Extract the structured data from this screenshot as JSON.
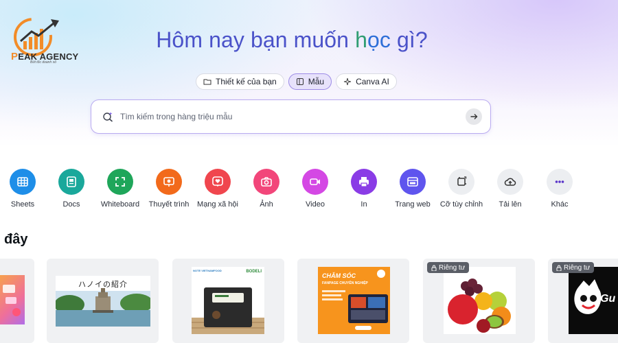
{
  "brand": {
    "logo_text": "EAK AGENCY",
    "logo_initial": "P",
    "tagline": "Bứt tốc doanh số"
  },
  "hero": {
    "headline_pre": "Hôm nay bạn muốn ",
    "headline_h": "h",
    "headline_oc": "ọc",
    "headline_post": " gì?"
  },
  "tabs": [
    {
      "label": "Thiết kế của bạn",
      "icon": "folder-icon",
      "active": false
    },
    {
      "label": "Mẫu",
      "icon": "template-icon",
      "active": true
    },
    {
      "label": "Canva AI",
      "icon": "sparkle-icon",
      "active": false
    }
  ],
  "search": {
    "placeholder": "Tìm kiếm trong hàng triệu mẫu"
  },
  "categories": [
    {
      "label": "Sheets",
      "icon": "sheets-icon",
      "color": "#1e8ee8"
    },
    {
      "label": "Docs",
      "icon": "docs-icon",
      "color": "#1aa89b"
    },
    {
      "label": "Whiteboard",
      "icon": "whiteboard-icon",
      "color": "#1fa65a"
    },
    {
      "label": "Thuyết trình",
      "icon": "presentation-icon",
      "color": "#f26a1b"
    },
    {
      "label": "Mạng xã hội",
      "icon": "social-heart-icon",
      "color": "#f0464e"
    },
    {
      "label": "Ảnh",
      "icon": "camera-icon",
      "color": "#f2467a"
    },
    {
      "label": "Video",
      "icon": "video-icon",
      "color": "#d448e4"
    },
    {
      "label": "In",
      "icon": "printer-icon",
      "color": "#8a3ce6"
    },
    {
      "label": "Trang web",
      "icon": "website-icon",
      "color": "#5f55ee"
    },
    {
      "label": "Cỡ tùy chỉnh",
      "icon": "custom-size-icon",
      "color": "#eceef1"
    },
    {
      "label": "Tải lên",
      "icon": "upload-cloud-icon",
      "color": "#eceef1"
    },
    {
      "label": "Khác",
      "icon": "more-dots-icon",
      "color": "#eceef1"
    }
  ],
  "recent": {
    "title": "đây",
    "cards": [
      {
        "badge": ""
      },
      {
        "badge": "",
        "thumb_title": "ハノイの紹介"
      },
      {
        "badge": "",
        "brand_left": "NOTE VIETNAMFOOD",
        "brand_right": "BODELI"
      },
      {
        "badge": "",
        "thumb_title": "CHĂM SÓC",
        "thumb_subtitle": "FANPAGE CHUYÊN NGHIỆP"
      },
      {
        "badge": "Riêng tư"
      },
      {
        "badge": "Riêng tư",
        "thumb_title": "Gu"
      }
    ]
  }
}
